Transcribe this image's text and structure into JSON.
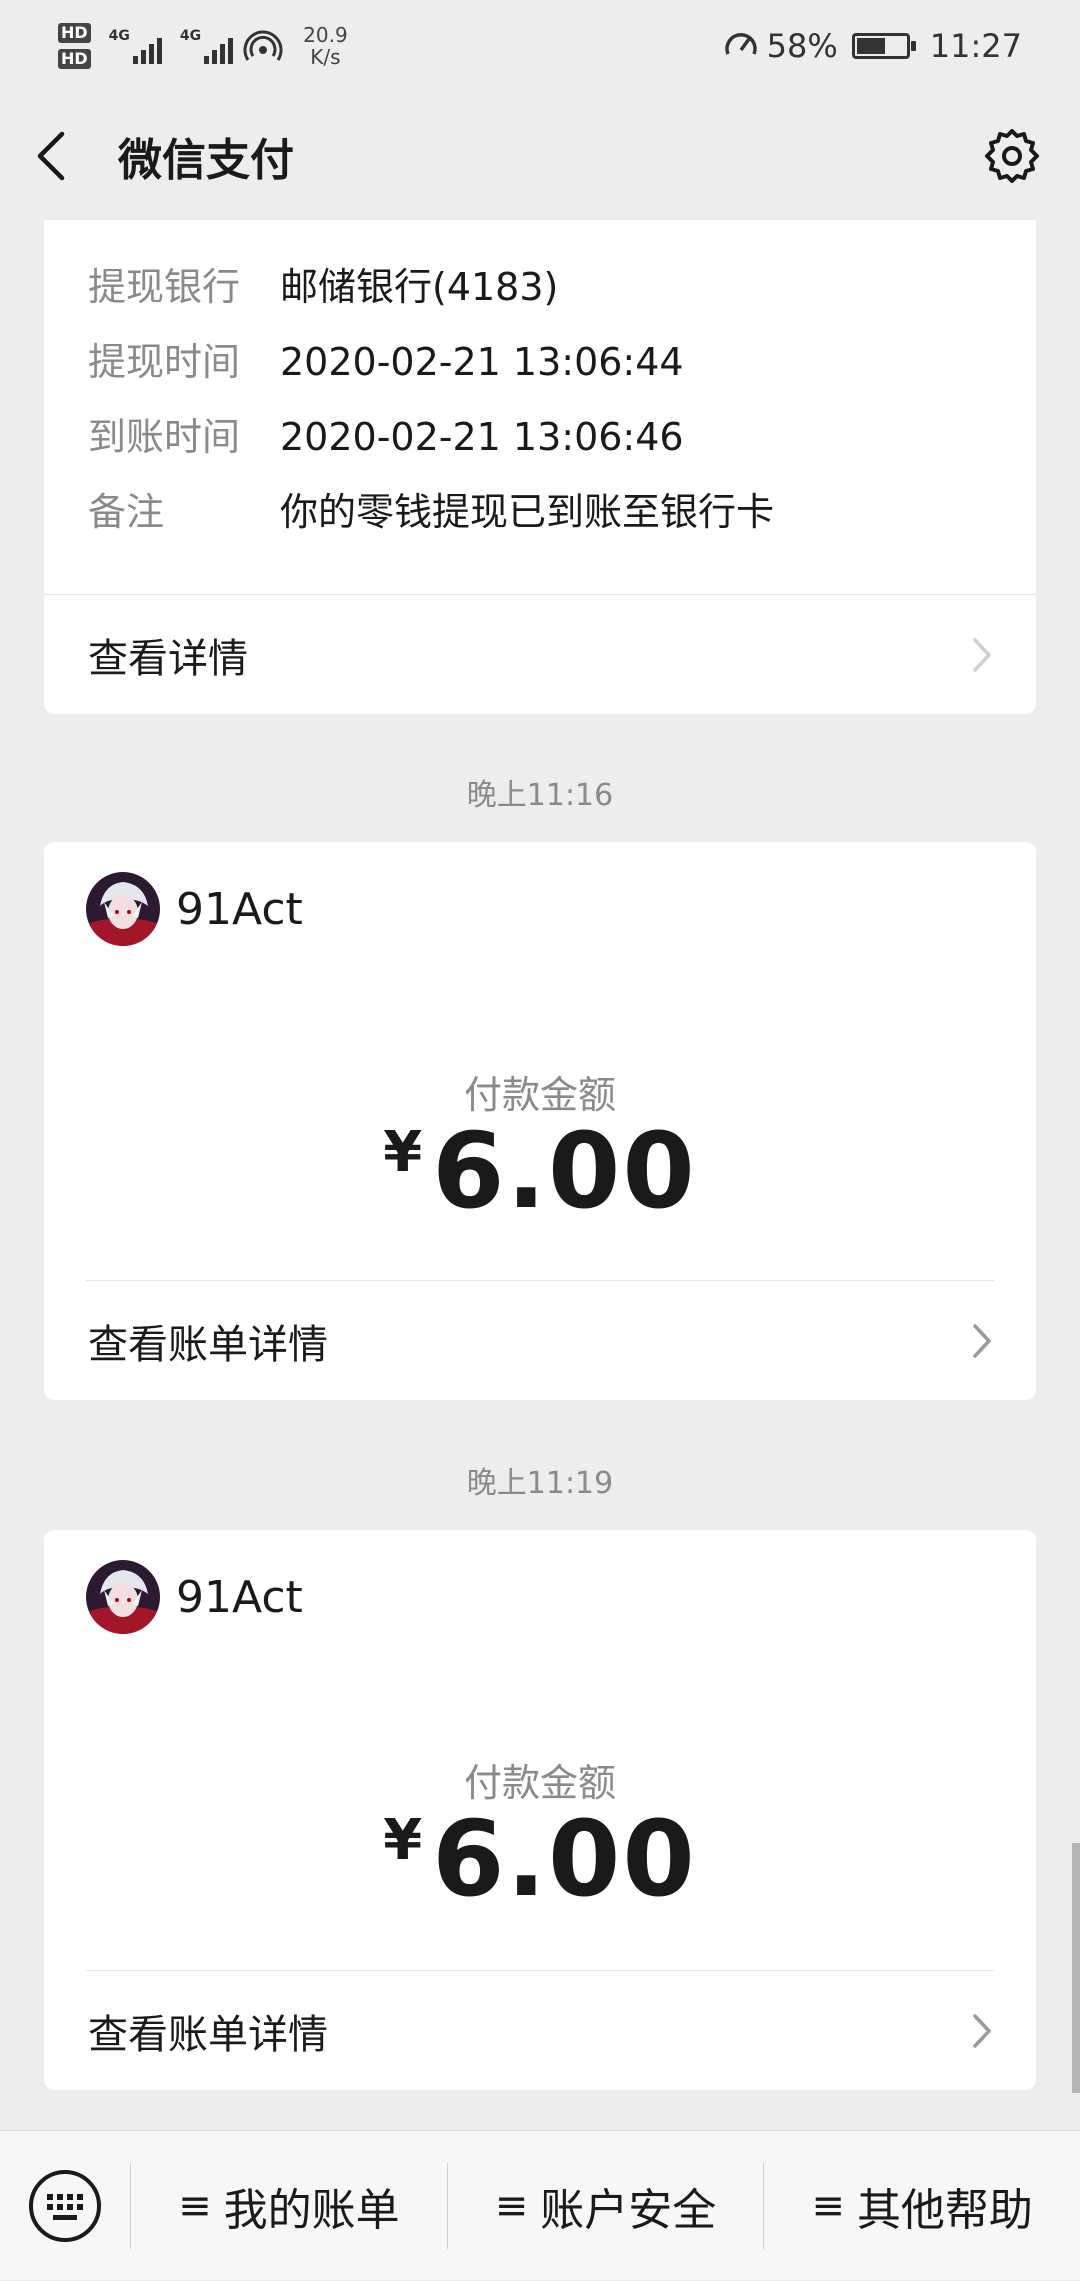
{
  "status_bar": {
    "hd1": "HD",
    "hd2": "HD",
    "net1": "4G",
    "net2": "4G",
    "speed_value": "20.9",
    "speed_unit": "K/s",
    "battery_percent": "58%",
    "battery_level": 0.58,
    "time": "11:27"
  },
  "nav": {
    "title": "微信支付"
  },
  "withdraw_card": {
    "rows": [
      {
        "key": "提现银行",
        "value": "邮储银行(4183)"
      },
      {
        "key": "提现时间",
        "value": "2020-02-21 13:06:44"
      },
      {
        "key": "到账时间",
        "value": "2020-02-21 13:06:46"
      },
      {
        "key": "备注",
        "value": "你的零钱提现已到账至银行卡"
      }
    ],
    "link_label": "查看详情"
  },
  "messages": [
    {
      "time": "晚上11:16",
      "merchant": "91Act",
      "amount_label": "付款金额",
      "currency": "¥",
      "amount": "6.00",
      "link_label": "查看账单详情"
    },
    {
      "time": "晚上11:19",
      "merchant": "91Act",
      "amount_label": "付款金额",
      "currency": "¥",
      "amount": "6.00",
      "link_label": "查看账单详情"
    }
  ],
  "bottom_menu": {
    "items": [
      {
        "label": "我的账单"
      },
      {
        "label": "账户安全"
      },
      {
        "label": "其他帮助"
      }
    ],
    "menu_glyph": "≡"
  },
  "icons": {
    "back": "back-chevron-icon",
    "settings": "gear-icon",
    "keyboard": "keyboard-icon",
    "chevron": "chevron-right-icon"
  },
  "colors": {
    "background": "#ededed",
    "card": "#ffffff",
    "secondary_text": "#8a8a8a",
    "primary_text": "#1a1a1a"
  }
}
